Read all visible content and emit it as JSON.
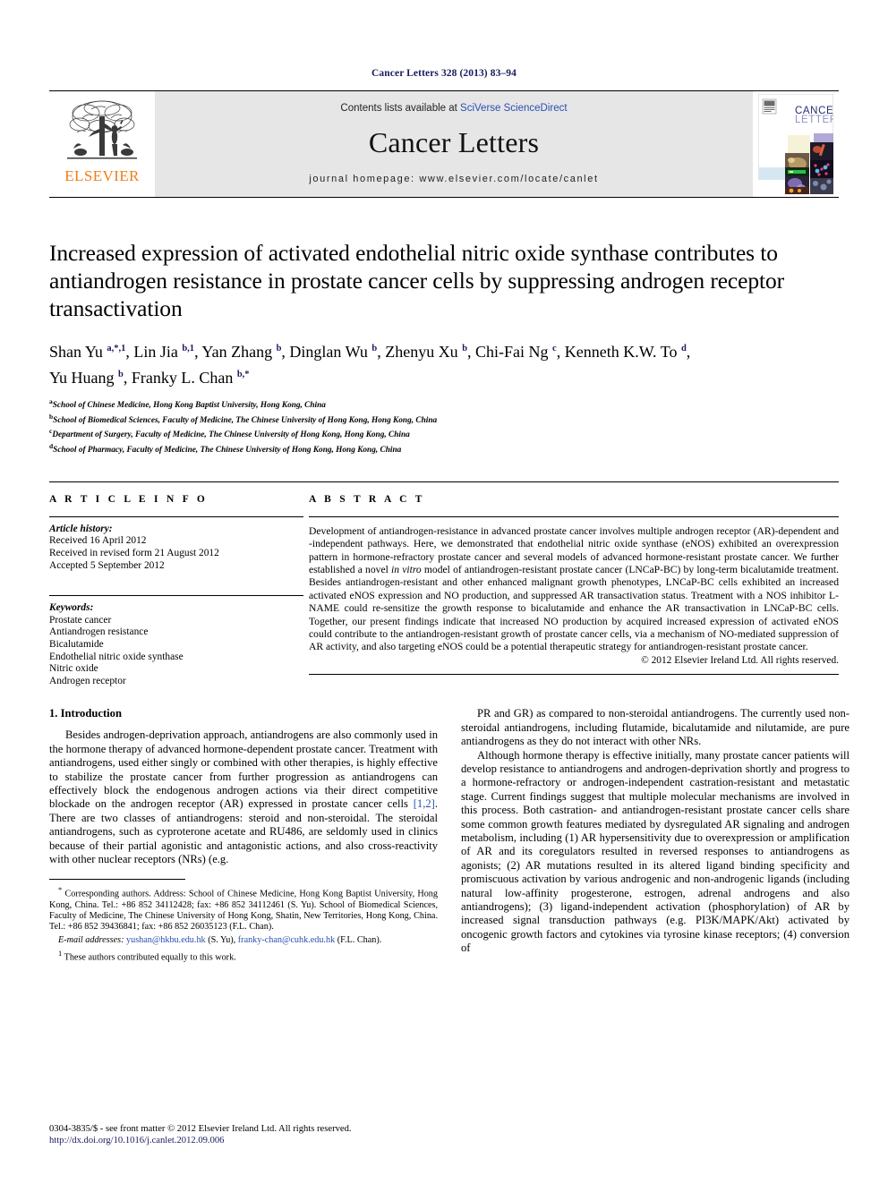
{
  "running_head": "Cancer Letters 328 (2013) 83–94",
  "masthead": {
    "publisher_name": "ELSEVIER",
    "contents_prefix": "Contents lists available at ",
    "contents_link": "SciVerse ScienceDirect",
    "journal_name": "Cancer Letters",
    "homepage_label": "journal homepage: www.elsevier.com/locate/canlet",
    "cover": {
      "title_line1": "CANCER",
      "title_line2": "LETTERS"
    }
  },
  "article": {
    "title": "Increased expression of activated endothelial nitric oxide synthase contributes to antiandrogen resistance in prostate cancer cells by suppressing androgen receptor transactivation",
    "authors_line1_parts": [
      {
        "name": "Shan Yu ",
        "sup": "a,*,1"
      },
      {
        "name": ", Lin Jia ",
        "sup": "b,1"
      },
      {
        "name": ", Yan Zhang ",
        "sup": "b"
      },
      {
        "name": ", Dinglan Wu ",
        "sup": "b"
      },
      {
        "name": ", Zhenyu Xu ",
        "sup": "b"
      },
      {
        "name": ", Chi-Fai Ng ",
        "sup": "c"
      },
      {
        "name": ", Kenneth K.W. To ",
        "sup": "d"
      },
      {
        "name": ",",
        "sup": ""
      }
    ],
    "authors_line2_parts": [
      {
        "name": "Yu Huang ",
        "sup": "b"
      },
      {
        "name": ", Franky L. Chan ",
        "sup": "b,*"
      }
    ],
    "affiliations": [
      {
        "marker": "a",
        "text": "School of Chinese Medicine, Hong Kong Baptist University, Hong Kong, China"
      },
      {
        "marker": "b",
        "text": "School of Biomedical Sciences, Faculty of Medicine, The Chinese University of Hong Kong, Hong Kong, China"
      },
      {
        "marker": "c",
        "text": "Department of Surgery, Faculty of Medicine, The Chinese University of Hong Kong, Hong Kong, China"
      },
      {
        "marker": "d",
        "text": "School of Pharmacy, Faculty of Medicine, The Chinese University of Hong Kong, Hong Kong, China"
      }
    ]
  },
  "article_info": {
    "heading": "A R T I C L E   I N F O",
    "history_label": "Article history:",
    "history": [
      "Received 16 April 2012",
      "Received in revised form 21 August 2012",
      "Accepted 5 September 2012"
    ],
    "keywords_label": "Keywords:",
    "keywords": [
      "Prostate cancer",
      "Antiandrogen resistance",
      "Bicalutamide",
      "Endothelial nitric oxide synthase",
      "Nitric oxide",
      "Androgen receptor"
    ]
  },
  "abstract": {
    "heading": "A B S T R A C T",
    "text_part1": "Development of antiandrogen-resistance in advanced prostate cancer involves multiple androgen receptor (AR)-dependent and -independent pathways. Here, we demonstrated that endothelial nitric oxide synthase (eNOS) exhibited an overexpression pattern in hormone-refractory prostate cancer and several models of advanced hormone-resistant prostate cancer. We further established a novel ",
    "italic1": "in vitro",
    "text_part2": " model of antiandrogen-resistant prostate cancer (LNCaP-BC) by long-term bicalutamide treatment. Besides antiandrogen-resistant and other enhanced malignant growth phenotypes, LNCaP-BC cells exhibited an increased activated eNOS expression and NO production, and suppressed AR transactivation status. Treatment with a NOS inhibitor L-NAME could re-sensitize the growth response to bicalutamide and enhance the AR transactivation in LNCaP-BC cells. Together, our present findings indicate that increased NO production by acquired increased expression of activated eNOS could contribute to the antiandrogen-resistant growth of prostate cancer cells, via a mechanism of NO-mediated suppression of AR activity, and also targeting eNOS could be a potential therapeutic strategy for antiandrogen-resistant prostate cancer.",
    "copyright": "© 2012 Elsevier Ireland Ltd. All rights reserved."
  },
  "body": {
    "section_title": "1. Introduction",
    "left_para_1": "Besides androgen-deprivation approach, antiandrogens are also commonly used in the hormone therapy of advanced hormone-dependent prostate cancer. Treatment with antiandrogens, used either singly or combined with other therapies, is highly effective to stabilize the prostate cancer from further progression as antiandrogens can effectively block the endogenous androgen actions via their direct competitive blockade on the androgen receptor (AR) expressed in prostate cancer cells ",
    "left_para_1_ref": "[1,2]",
    "left_para_1_cont": ". There are two classes of antiandrogens: steroid and non-steroidal. The steroidal antiandrogens, such as cyproterone acetate and RU486, are seldomly used in clinics because of their partial agonistic and antagonistic actions, and also cross-reactivity with other nuclear receptors (NRs) (e.g.",
    "right_para_1": "PR and GR) as compared to non-steroidal antiandrogens. The currently used non-steroidal antiandrogens, including flutamide, bicalutamide and nilutamide, are pure antiandrogens as they do not interact with other NRs.",
    "right_para_2": "Although hormone therapy is effective initially, many prostate cancer patients will develop resistance to antiandrogens and androgen-deprivation shortly and progress to a hormone-refractory or androgen-independent castration-resistant and metastatic stage. Current findings suggest that multiple molecular mechanisms are involved in this process. Both castration- and antiandrogen-resistant prostate cancer cells share some common growth features mediated by dysregulated AR signaling and androgen metabolism, including (1) AR hypersensitivity due to overexpression or amplification of AR and its coregulators resulted in reversed responses to antiandrogens as agonists; (2) AR mutations resulted in its altered ligand binding specificity and promiscuous activation by various androgenic and non-androgenic ligands (including natural low-affinity progesterone, estrogen, adrenal androgens and also antiandrogens); (3) ligand-independent activation (phosphorylation) of AR by increased signal transduction pathways (e.g. PI3K/MAPK/Akt) activated by oncogenic growth factors and cytokines via tyrosine kinase receptors; (4) conversion of"
  },
  "footnotes": {
    "corresponding_marker": "*",
    "corresponding": " Corresponding authors. Address: School of Chinese Medicine, Hong Kong Baptist University, Hong Kong, China. Tel.: +86 852 34112428; fax: +86 852 34112461 (S. Yu). School of Biomedical Sciences, Faculty of Medicine, The Chinese University of Hong Kong, Shatin, New Territories, Hong Kong, China. Tel.: +86 852 39436841; fax: +86 852 26035123 (F.L. Chan).",
    "email_label": "E-mail addresses:",
    "email_1": "yushan@hkbu.edu.hk",
    "email_1_owner": " (S. Yu), ",
    "email_2": "franky-chan@cuhk.edu.hk",
    "email_2_owner": " (F.L. Chan).",
    "equal_marker": "1",
    "equal_contrib": " These authors contributed equally to this work."
  },
  "bottom": {
    "issn_line": "0304-3835/$ - see front matter © 2012 Elsevier Ireland Ltd. All rights reserved.",
    "doi": "http://dx.doi.org/10.1016/j.canlet.2012.09.006"
  },
  "colors": {
    "link": "#2b4fb1",
    "navy": "#1a1a5e",
    "elsevier_orange": "#f07d1a",
    "band_gray": "#e6e6e6"
  }
}
